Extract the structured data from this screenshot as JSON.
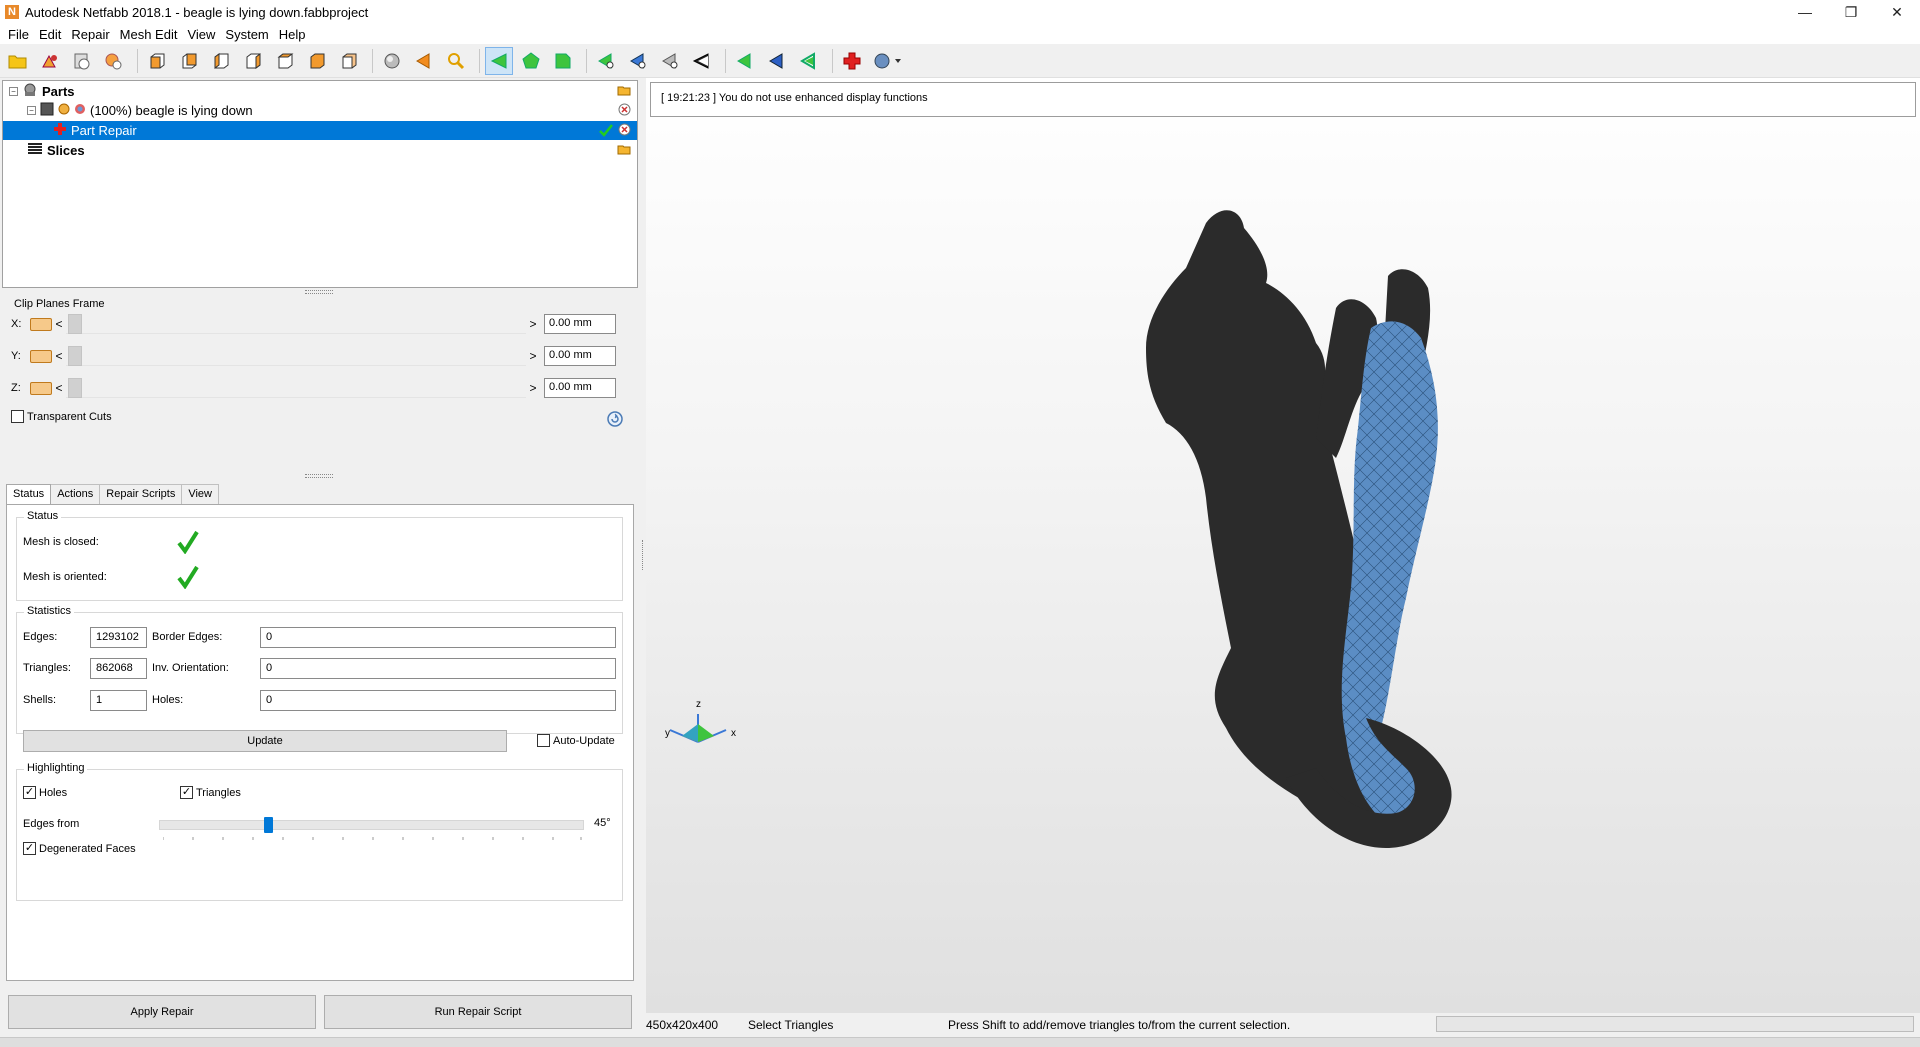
{
  "window": {
    "title": "Autodesk Netfabb 2018.1 - beagle is lying down.fabbproject",
    "app_icon": "N",
    "controls": {
      "minimize": "—",
      "restore": "❐",
      "close": "✕"
    }
  },
  "menu": [
    "File",
    "Edit",
    "Repair",
    "Mesh Edit",
    "View",
    "System",
    "Help"
  ],
  "tree": {
    "parts_label": "Parts",
    "part_label": "(100%) beagle is lying down",
    "repair_label": "Part Repair",
    "slices_label": "Slices"
  },
  "clip_planes": {
    "title": "Clip Planes Frame",
    "rows": [
      {
        "axis": "X:",
        "value": "0.00 mm"
      },
      {
        "axis": "Y:",
        "value": "0.00 mm"
      },
      {
        "axis": "Z:",
        "value": "0.00 mm"
      }
    ],
    "arrow_left": "<",
    "arrow_right": ">",
    "transparent_cuts": "Transparent Cuts"
  },
  "tabs": [
    "Status",
    "Actions",
    "Repair Scripts",
    "View"
  ],
  "status": {
    "group_title": "Status",
    "mesh_closed": "Mesh is closed:",
    "mesh_oriented": "Mesh is oriented:"
  },
  "statistics": {
    "group_title": "Statistics",
    "edges_label": "Edges:",
    "edges_value": "1293102",
    "border_edges_label": "Border Edges:",
    "border_edges_value": "0",
    "triangles_label": "Triangles:",
    "triangles_value": "862068",
    "inv_orientation_label": "Inv. Orientation:",
    "inv_orientation_value": "0",
    "shells_label": "Shells:",
    "shells_value": "1",
    "holes_label": "Holes:",
    "holes_value": "0",
    "update_button": "Update",
    "auto_update": "Auto-Update"
  },
  "highlighting": {
    "group_title": "Highlighting",
    "holes": "Holes",
    "triangles": "Triangles",
    "edges_from": "Edges from",
    "edges_value": "45°",
    "edges_slider_fraction": 0.25,
    "degenerated_faces": "Degenerated Faces"
  },
  "buttons": {
    "apply_repair": "Apply Repair",
    "run_repair_script": "Run Repair Script"
  },
  "log": "[ 19:21:23 ] You do not use enhanced display functions",
  "axes": {
    "x": "x",
    "y": "y",
    "z": "z"
  },
  "statusbar": {
    "size": "450x420x400",
    "mode": "Select Triangles",
    "hint": "Press Shift to add/remove triangles to/from the current selection."
  },
  "colors": {
    "selection": "#0078d7",
    "mesh_dark": "#2a2a2a",
    "mesh_highlight": "#5b8dc4",
    "check": "#22aa22"
  }
}
